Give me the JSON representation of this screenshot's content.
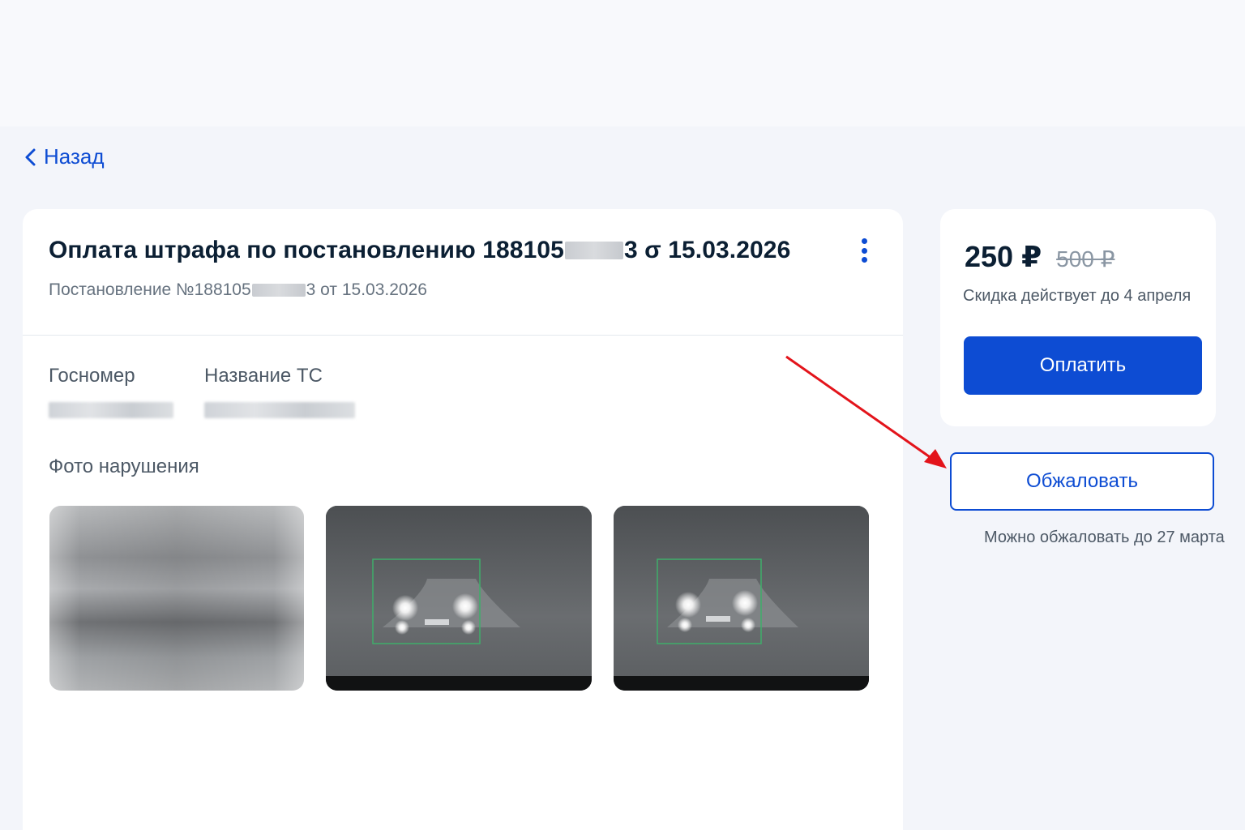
{
  "nav": {
    "back_label": "Назад"
  },
  "fine": {
    "title_prefix": "Оплата штрафа по постановлению 188105",
    "title_suffix": "3 σ 15.03.2026",
    "subtitle_prefix": "Постановление №188105",
    "subtitle_suffix": "3 от 15.03.2026",
    "fields": [
      {
        "label": "Госномер"
      },
      {
        "label": "Название ТС"
      }
    ],
    "photos_label": "Фото нарушения"
  },
  "payment": {
    "price_current": "250 ₽",
    "price_old": "500 ₽",
    "discount_note": "Скидка действует до 4 апреля",
    "pay_label": "Оплатить"
  },
  "appeal": {
    "button_label": "Обжаловать",
    "note": "Можно обжаловать до 27 марта"
  },
  "colors": {
    "accent": "#0d4cd3",
    "annotation_arrow": "#e3141b",
    "detection_box": "#3fae6a"
  }
}
